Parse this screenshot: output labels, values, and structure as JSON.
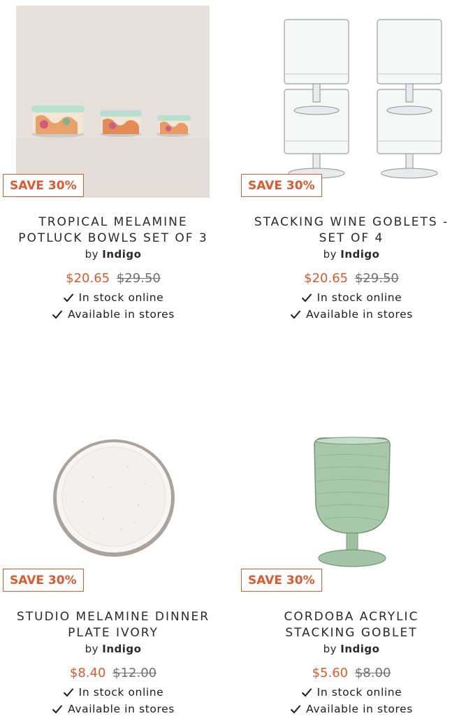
{
  "products": [
    {
      "badge": "SAVE 30%",
      "title_line1": "TROPICAL MELAMINE",
      "title_line2": "POTLUCK BOWLS SET OF 3",
      "by_prefix": "by",
      "brand": "Indigo",
      "sale_price": "$20.65",
      "original_price": "$29.50",
      "stock_online": "In stock online",
      "stock_stores": "Available in stores"
    },
    {
      "badge": "SAVE 30%",
      "title_line1": "STACKING WINE GOBLETS -",
      "title_line2": "SET OF 4",
      "by_prefix": "by",
      "brand": "Indigo",
      "sale_price": "$20.65",
      "original_price": "$29.50",
      "stock_online": "In stock online",
      "stock_stores": "Available in stores"
    },
    {
      "badge": "SAVE 30%",
      "title_line1": "STUDIO MELAMINE DINNER",
      "title_line2": "PLATE IVORY",
      "by_prefix": "by",
      "brand": "Indigo",
      "sale_price": "$8.40",
      "original_price": "$12.00",
      "stock_online": "In stock online",
      "stock_stores": "Available in stores"
    },
    {
      "badge": "SAVE 30%",
      "title_line1": "CORDOBA ACRYLIC",
      "title_line2": "STACKING GOBLET",
      "by_prefix": "by",
      "brand": "Indigo",
      "sale_price": "$5.60",
      "original_price": "$8.00",
      "stock_online": "In stock online",
      "stock_stores": "Available in stores"
    }
  ],
  "colors": {
    "accent": "#e0582d",
    "text": "#1c1c1c",
    "muted": "#707070"
  },
  "icons": {
    "availability": "check-icon"
  }
}
